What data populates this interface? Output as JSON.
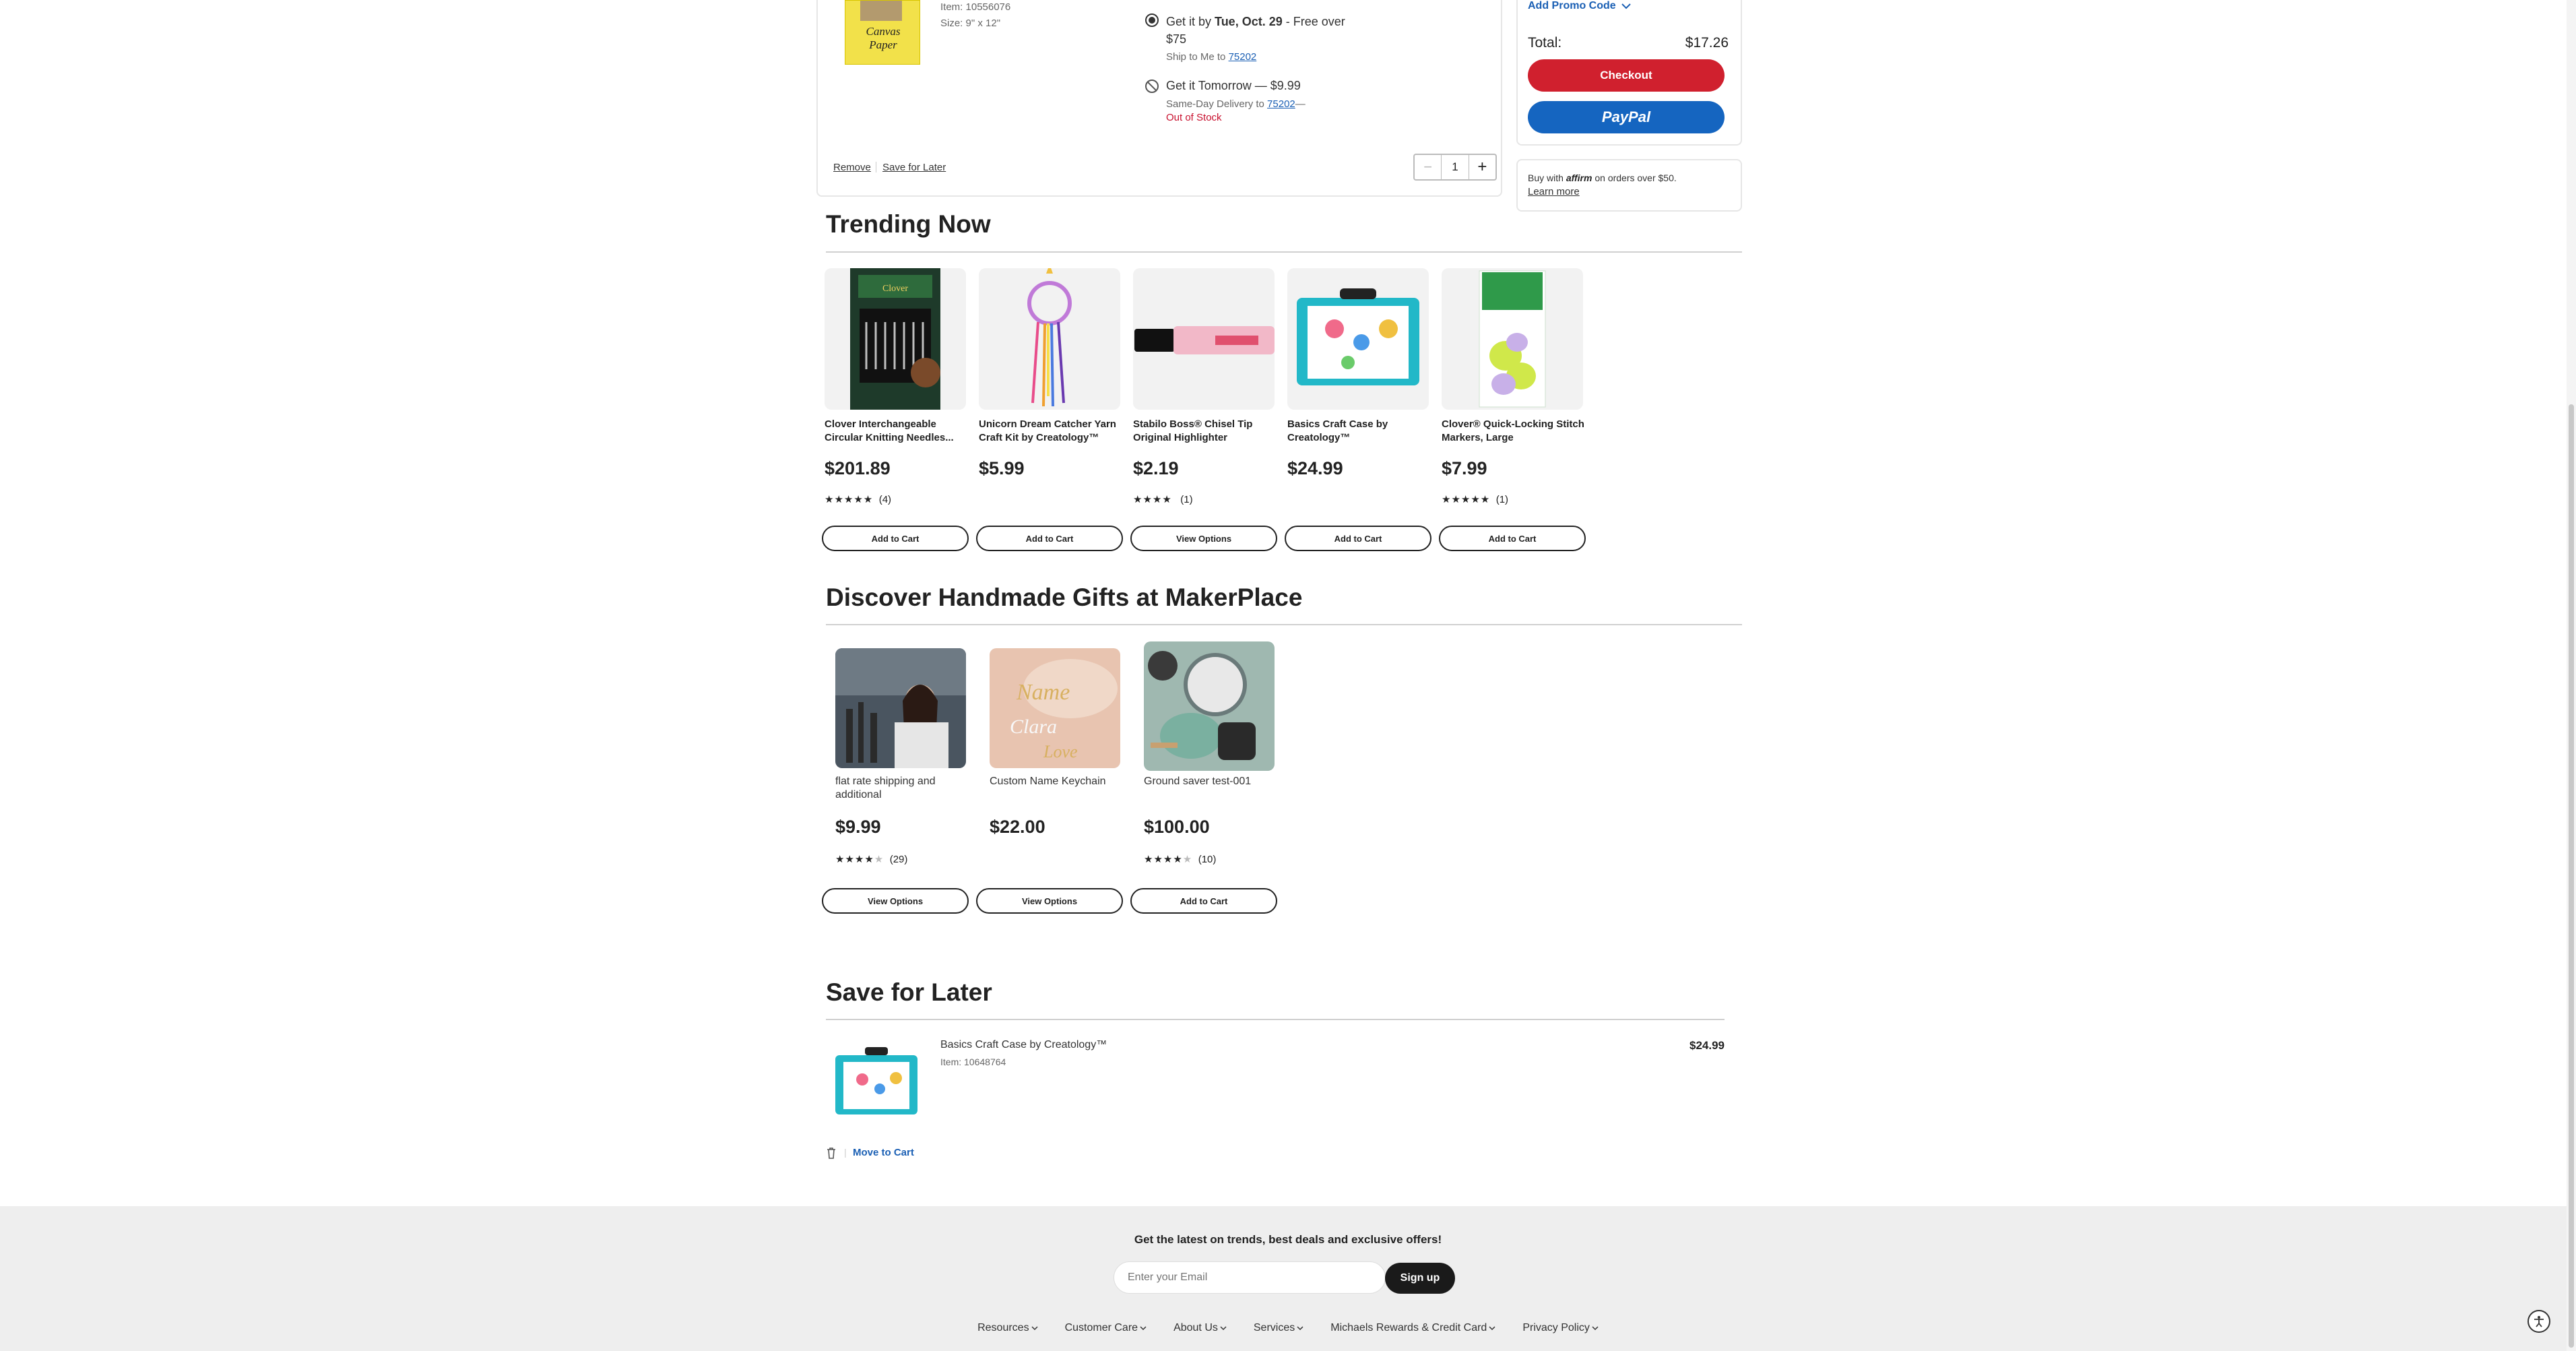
{
  "cart_item": {
    "item_number": "Item: 10556076",
    "size": "Size: 9\" x 12\"",
    "thumb_text": "Canvas Paper",
    "ship_option": {
      "prefix": "Get it by ",
      "date": "Tue, Oct. 29",
      "suffix": " - Free over",
      "threshold": "$75",
      "ship_to": "Ship to Me to ",
      "zip": "75202"
    },
    "sameday_option": {
      "title": "Get it Tomorrow — $9.99",
      "desc": "Same-Day Delivery to ",
      "zip": "75202",
      "dash": "—",
      "status": "Out of Stock"
    },
    "remove_label": "Remove",
    "save_later_label": "Save for Later",
    "quantity": "1",
    "minus": "−",
    "plus": "+"
  },
  "summary": {
    "promo_label": "Add Promo Code",
    "total_label": "Total:",
    "total_value": "$17.26",
    "checkout_label": "Checkout",
    "paypal_label": "PayPal",
    "affirm_prefix": "Buy with ",
    "affirm_brand": "affirm",
    "affirm_suffix": " on orders over $50.",
    "learn_more": "Learn more"
  },
  "trending": {
    "title": "Trending Now",
    "products": [
      {
        "name": "Clover Interchangeable Circular Knitting Needles...",
        "price": "$201.89",
        "stars": "★★★★★",
        "count": "(4)",
        "rating": 5,
        "button": "Add to Cart"
      },
      {
        "name": "Unicorn Dream Catcher Yarn Craft Kit by Creatology™",
        "price": "$5.99",
        "stars": "",
        "count": "",
        "rating": 0,
        "button": "Add to Cart"
      },
      {
        "name": "Stabilo Boss® Chisel Tip Original Highlighter",
        "price": "$2.19",
        "stars": "★★★★",
        "count": "(1)",
        "rating": 4,
        "button": "View Options"
      },
      {
        "name": "Basics Craft Case by Creatology™",
        "price": "$24.99",
        "stars": "",
        "count": "",
        "rating": 0,
        "button": "Add to Cart"
      },
      {
        "name": "Clover® Quick-Locking Stitch Markers, Large",
        "price": "$7.99",
        "stars": "★★★★★",
        "count": "(1)",
        "rating": 5,
        "button": "Add to Cart"
      }
    ]
  },
  "makerplace": {
    "title": "Discover Handmade Gifts at MakerPlace",
    "products": [
      {
        "name": "flat rate shipping and additional",
        "price": "$9.99",
        "stars": "★★★★",
        "empty": "★",
        "count": "(29)",
        "rating": 4.5,
        "button": "View Options"
      },
      {
        "name": "Custom Name Keychain",
        "price": "$22.00",
        "stars": "",
        "empty": "",
        "count": "",
        "rating": 0,
        "button": "View Options"
      },
      {
        "name": "Ground saver test-001",
        "price": "$100.00",
        "stars": "★★★★",
        "empty": "★",
        "count": "(10)",
        "rating": 4,
        "button": "Add to Cart"
      }
    ]
  },
  "save_for_later": {
    "title": "Save for Later",
    "item_name": "Basics Craft Case by Creatology™",
    "item_number": "Item: 10648764",
    "price": "$24.99",
    "move_label": "Move to Cart",
    "separator": "|"
  },
  "footer": {
    "newsletter": "Get the latest on trends, best deals and exclusive offers!",
    "email_placeholder": "Enter your Email",
    "signup_label": "Sign up",
    "links": [
      "Resources",
      "Customer Care",
      "About Us",
      "Services",
      "Michaels Rewards & Credit Card",
      "Privacy Policy"
    ]
  },
  "colors": {
    "checkout": "#d0202e",
    "paypal": "#1565c0",
    "link": "#1a5fb4",
    "out_of_stock": "#c8102e"
  }
}
